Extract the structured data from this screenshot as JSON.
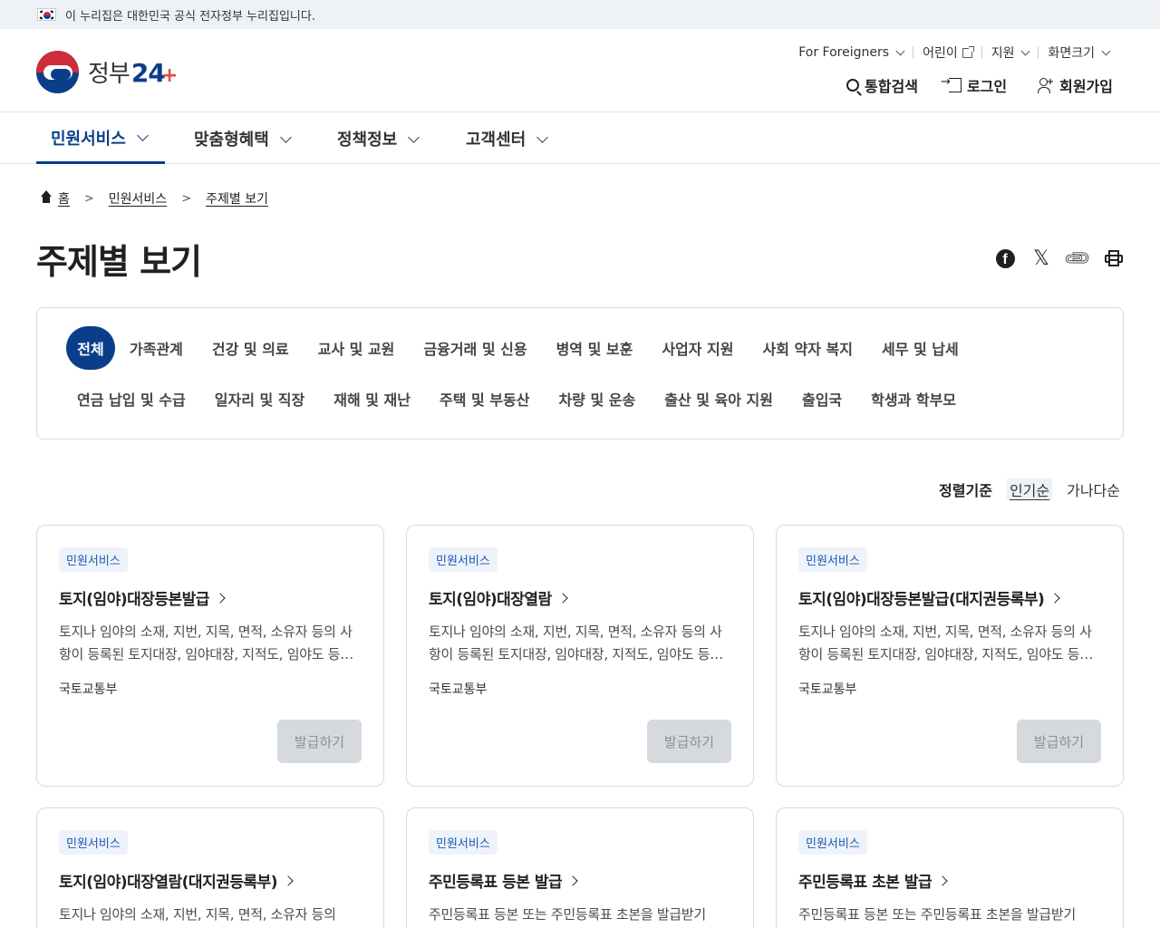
{
  "gov_banner": {
    "text": "이 누리집은 대한민국 공식 전자정부 누리집입니다."
  },
  "logo": {
    "text": "정부",
    "num": "24",
    "plus": "+"
  },
  "util_menu": [
    {
      "label": "For Foreigners"
    },
    {
      "label": "어린이"
    },
    {
      "label": "지원"
    },
    {
      "label": "화면크기"
    }
  ],
  "auth": {
    "search": "통합검색",
    "login": "로그인",
    "signup": "회원가입"
  },
  "gnb": [
    {
      "label": "민원서비스"
    },
    {
      "label": "맞춤형혜택"
    },
    {
      "label": "정책정보"
    },
    {
      "label": "고객센터"
    }
  ],
  "breadcrumb": {
    "home": "홈",
    "level1": "민원서비스",
    "level2": "주제별 보기"
  },
  "page_title": "주제별 보기",
  "categories_row1": [
    "전체",
    "가족관계",
    "건강 및 의료",
    "교사 및 교원",
    "금융거래 및 신용",
    "병역 및 보훈",
    "사업자 지원",
    "사회 약자 복지",
    "세무 및 납세"
  ],
  "categories_row2": [
    "연금 납입 및 수급",
    "일자리 및 직장",
    "재해 및 재난",
    "주택 및 부동산",
    "차량 및 운송",
    "출산 및 육아 지원",
    "출입국",
    "학생과 학부모"
  ],
  "sort": {
    "label": "정렬기준",
    "popular": "인기순",
    "alpha": "가나다순"
  },
  "cards": [
    {
      "badge": "민원서비스",
      "title": "토지(임야)대장등본발급",
      "desc": "토지나 임야의 소재, 지번, 지목, 면적, 소유자 등의 사항이 등록된 토지대장, 임야대장, 지적도, 임야도 등을 발급받을 수 있습니다.",
      "org": "국토교통부",
      "button": "발급하기"
    },
    {
      "badge": "민원서비스",
      "title": "토지(임야)대장열람",
      "desc": "토지나 임야의 소재, 지번, 지목, 면적, 소유자 등의 사항이 등록된 토지대장, 임야대장, 지적도, 임야도 등을 열람할 수 있습니다.",
      "org": "국토교통부",
      "button": "발급하기"
    },
    {
      "badge": "민원서비스",
      "title": "토지(임야)대장등본발급(대지권등록부)",
      "desc": "토지나 임야의 소재, 지번, 지목, 면적, 소유자 등의 사항이 등록된 토지대장, 임야대장, 지적도, 임야도 등을 발급받을 수 있습니다.",
      "org": "국토교통부",
      "button": "발급하기"
    },
    {
      "badge": "민원서비스",
      "title": "토지(임야)대장열람(대지권등록부)",
      "desc": "토지나 임야의 소재, 지번, 지목, 면적, 소유자 등의",
      "org": "",
      "button": ""
    },
    {
      "badge": "민원서비스",
      "title": "주민등록표 등본 발급",
      "desc": "주민등록표 등본 또는 주민등록표 초본을 발급받기",
      "org": "",
      "button": ""
    },
    {
      "badge": "민원서비스",
      "title": "주민등록표 초본 발급",
      "desc": "주민등록표 등본 또는 주민등록표 초본을 발급받기",
      "org": "",
      "button": ""
    }
  ]
}
